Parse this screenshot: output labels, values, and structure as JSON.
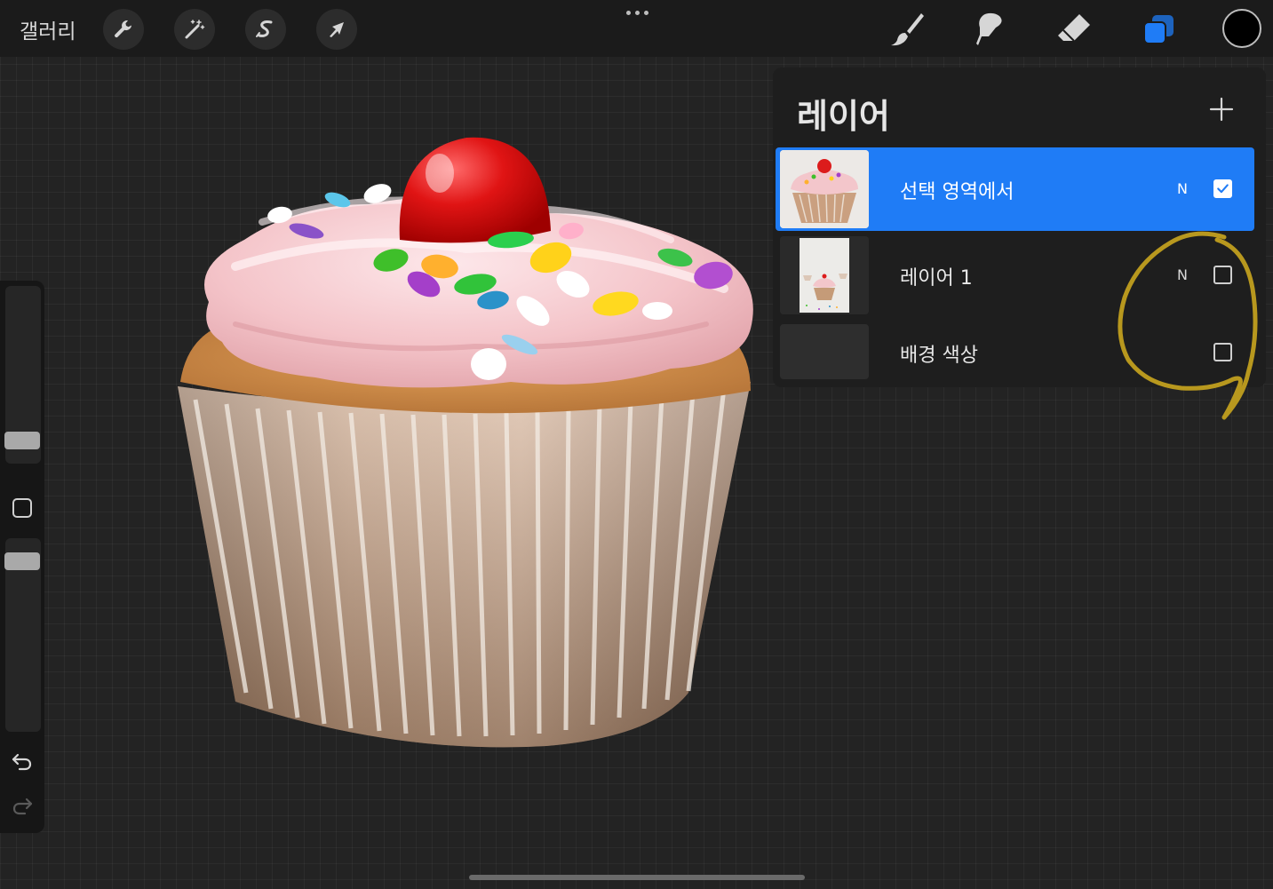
{
  "toolbar": {
    "gallery_label": "갤러리",
    "left_tools": [
      {
        "name": "actions",
        "icon": "wrench-icon"
      },
      {
        "name": "adjustments",
        "icon": "magic-wand-icon"
      },
      {
        "name": "selection",
        "icon": "selection-s-icon"
      },
      {
        "name": "transform",
        "icon": "arrow-cursor-icon"
      }
    ],
    "right_tools": [
      {
        "name": "brush",
        "icon": "brush-icon"
      },
      {
        "name": "smudge",
        "icon": "smudge-icon"
      },
      {
        "name": "eraser",
        "icon": "eraser-icon"
      },
      {
        "name": "layers",
        "icon": "layers-icon",
        "active": true
      }
    ],
    "current_color": "#000000",
    "accent_color": "#1f7cf6"
  },
  "layers_panel": {
    "title": "레이어",
    "layers": [
      {
        "name": "선택 영역에서",
        "blend_mode": "N",
        "visible": true,
        "active": true
      },
      {
        "name": "레이어 1",
        "blend_mode": "N",
        "visible": false,
        "active": false
      },
      {
        "name": "배경 색상",
        "blend_mode": "",
        "visible": false,
        "active": false
      }
    ]
  }
}
